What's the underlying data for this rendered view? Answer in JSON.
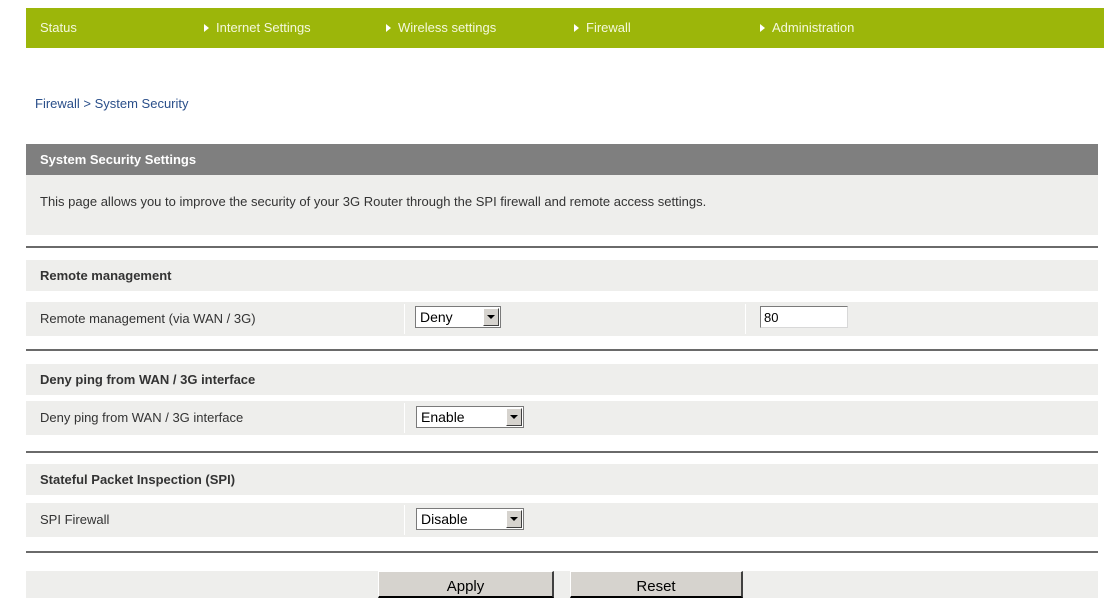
{
  "nav": {
    "status": "Status",
    "internet": "Internet Settings",
    "wireless": "Wireless settings",
    "firewall": "Firewall",
    "administration": "Administration"
  },
  "breadcrumb": "Firewall > System Security",
  "section": {
    "title": "System Security Settings",
    "description": "This page allows you to improve the security of your 3G Router through the SPI firewall and remote access settings."
  },
  "remote_management": {
    "group_title": "Remote management",
    "label": "Remote management (via WAN / 3G)",
    "select_value": "Deny",
    "port_value": "80"
  },
  "deny_ping": {
    "group_title": "Deny ping from WAN / 3G interface",
    "label": "Deny ping from WAN / 3G interface",
    "select_value": "Enable"
  },
  "spi": {
    "group_title": "Stateful Packet Inspection (SPI)",
    "label": "SPI Firewall",
    "select_value": "Disable"
  },
  "buttons": {
    "apply": "Apply",
    "reset": "Reset"
  },
  "colors": {
    "nav_bar": "#9cb60a",
    "section_header": "#7f7f7f",
    "panel": "#eeeeec",
    "breadcrumb_link": "#2a4f8a"
  },
  "icons": {
    "nav_arrow": "triangle-right-icon",
    "select_arrow": "chevron-down-icon"
  }
}
